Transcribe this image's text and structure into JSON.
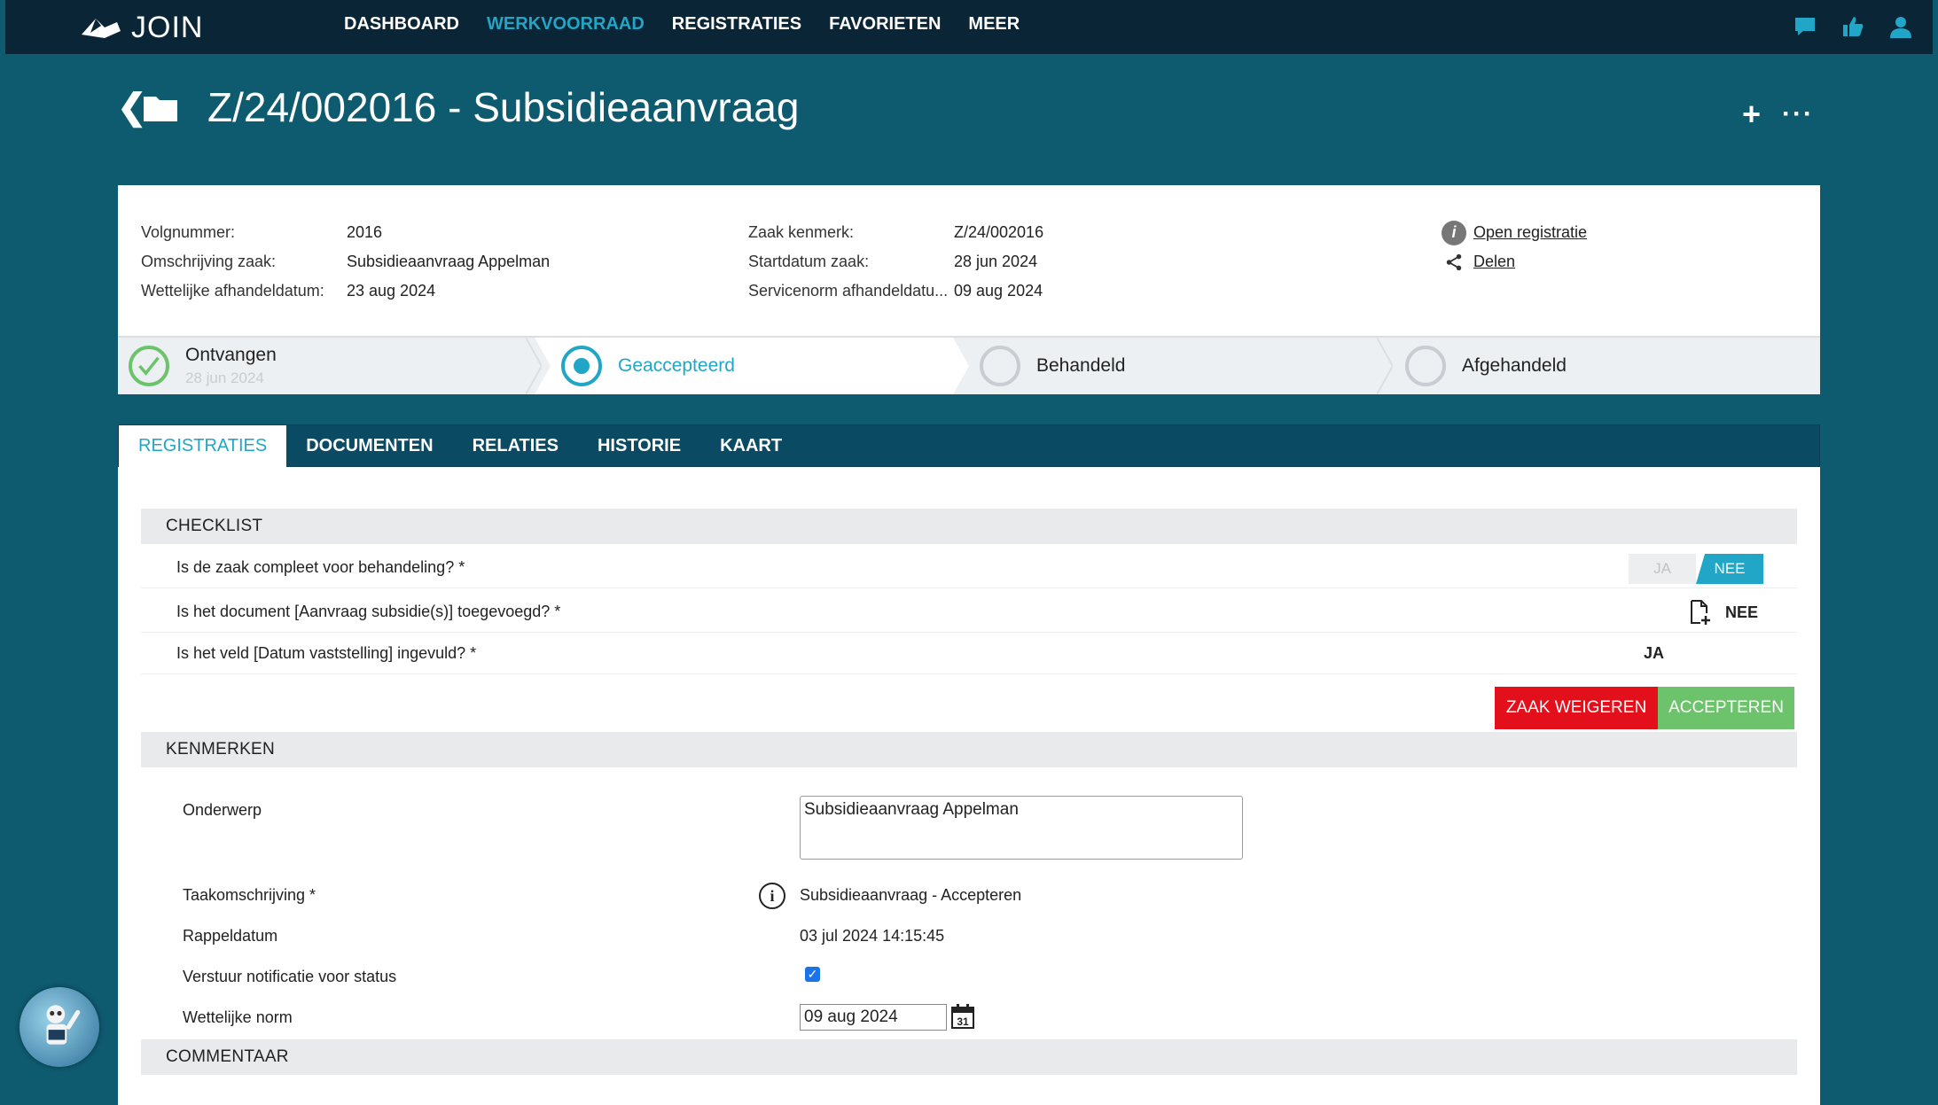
{
  "app": {
    "name": "JOIN"
  },
  "nav": {
    "items": [
      {
        "label": "DASHBOARD"
      },
      {
        "label": "WERKVOORRAAD"
      },
      {
        "label": "REGISTRATIES"
      },
      {
        "label": "FAVORIETEN"
      },
      {
        "label": "MEER"
      }
    ],
    "active": "WERKVOORRAAD"
  },
  "icons": [
    "chat-icon",
    "thumbs-up-icon",
    "user-icon",
    "back-icon",
    "folder-icon",
    "plus-icon",
    "more-icon",
    "info-icon",
    "share-icon",
    "add-document-icon",
    "calendar-icon"
  ],
  "page": {
    "title": "Z/24/002016 - Subsidieaanvraag"
  },
  "details": {
    "col1": [
      {
        "label": "Volgnummer:",
        "value": "2016"
      },
      {
        "label": "Omschrijving zaak:",
        "value": "Subsidieaanvraag Appelman"
      },
      {
        "label": "Wettelijke afhandeldatum:",
        "value": "23 aug 2024"
      }
    ],
    "col2": [
      {
        "label": "Zaak kenmerk:",
        "value": "Z/24/002016"
      },
      {
        "label": "Startdatum zaak:",
        "value": "28 jun 2024"
      },
      {
        "label": "Servicenorm afhandeldatu...",
        "value": "09 aug 2024"
      }
    ],
    "links": [
      {
        "label": "Open registratie"
      },
      {
        "label": "Delen"
      }
    ]
  },
  "steps": [
    {
      "label": "Ontvangen",
      "date": "28 jun 2024",
      "status": "done"
    },
    {
      "label": "Geaccepteerd",
      "status": "current"
    },
    {
      "label": "Behandeld",
      "status": "pending"
    },
    {
      "label": "Afgehandeld",
      "status": "pending"
    }
  ],
  "tabs": [
    {
      "label": "REGISTRATIES"
    },
    {
      "label": "DOCUMENTEN"
    },
    {
      "label": "RELATIES"
    },
    {
      "label": "HISTORIE"
    },
    {
      "label": "KAART"
    }
  ],
  "checklist": {
    "title": "CHECKLIST",
    "items": [
      {
        "question": "Is de zaak compleet voor behandeling? *",
        "options": [
          "JA",
          "NEE"
        ],
        "selected": "NEE"
      },
      {
        "question": "Is het document [Aanvraag subsidie(s)] toegevoegd? *",
        "value": "NEE"
      },
      {
        "question": "Is het veld [Datum vaststelling] ingevuld? *",
        "value": "JA"
      }
    ]
  },
  "buttons": {
    "reject": "ZAAK WEIGEREN",
    "accept": "ACCEPTEREN"
  },
  "kenmerken": {
    "title": "KENMERKEN",
    "onderwerp_label": "Onderwerp",
    "onderwerp_value": "Subsidieaanvraag Appelman",
    "taak_label": "Taakomschrijving *",
    "taak_value": "Subsidieaanvraag - Accepteren",
    "rappel_label": "Rappeldatum",
    "rappel_value": "03 jul 2024 14:15:45",
    "notificatie_label": "Verstuur notificatie voor status",
    "notificatie_checked": true,
    "norm_label": "Wettelijke norm",
    "norm_value": "09 aug 2024",
    "calendar_day": "31"
  },
  "commentaar": {
    "title": "COMMENTAAR"
  },
  "colors": {
    "accent": "#22a6c7",
    "reject": "#e3101c",
    "accept": "#6cc36b",
    "topbar": "#0a2535",
    "background": "#0e5a6e"
  }
}
